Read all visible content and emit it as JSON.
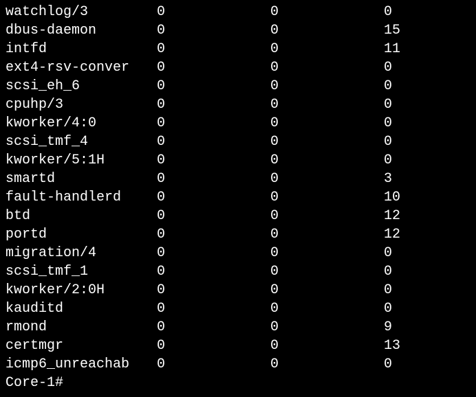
{
  "rows": [
    {
      "name": "watchlog/3",
      "v1": "0",
      "v2": "0",
      "v3": "0"
    },
    {
      "name": "dbus-daemon",
      "v1": "0",
      "v2": "0",
      "v3": "15"
    },
    {
      "name": "intfd",
      "v1": "0",
      "v2": "0",
      "v3": "11"
    },
    {
      "name": "ext4-rsv-conver",
      "v1": "0",
      "v2": "0",
      "v3": "0"
    },
    {
      "name": "scsi_eh_6",
      "v1": "0",
      "v2": "0",
      "v3": "0"
    },
    {
      "name": "cpuhp/3",
      "v1": "0",
      "v2": "0",
      "v3": "0"
    },
    {
      "name": "kworker/4:0",
      "v1": "0",
      "v2": "0",
      "v3": "0"
    },
    {
      "name": "scsi_tmf_4",
      "v1": "0",
      "v2": "0",
      "v3": "0"
    },
    {
      "name": "kworker/5:1H",
      "v1": "0",
      "v2": "0",
      "v3": "0"
    },
    {
      "name": "smartd",
      "v1": "0",
      "v2": "0",
      "v3": "3"
    },
    {
      "name": "fault-handlerd",
      "v1": "0",
      "v2": "0",
      "v3": "10"
    },
    {
      "name": "btd",
      "v1": "0",
      "v2": "0",
      "v3": "12"
    },
    {
      "name": "portd",
      "v1": "0",
      "v2": "0",
      "v3": "12"
    },
    {
      "name": "migration/4",
      "v1": "0",
      "v2": "0",
      "v3": "0"
    },
    {
      "name": "scsi_tmf_1",
      "v1": "0",
      "v2": "0",
      "v3": "0"
    },
    {
      "name": "kworker/2:0H",
      "v1": "0",
      "v2": "0",
      "v3": "0"
    },
    {
      "name": "kauditd",
      "v1": "0",
      "v2": "0",
      "v3": "0"
    },
    {
      "name": "rmond",
      "v1": "0",
      "v2": "0",
      "v3": "9"
    },
    {
      "name": "certmgr",
      "v1": "0",
      "v2": "0",
      "v3": "13"
    },
    {
      "name": "icmp6_unreachab",
      "v1": "0",
      "v2": "0",
      "v3": "0"
    }
  ],
  "prompt": "Core-1#"
}
